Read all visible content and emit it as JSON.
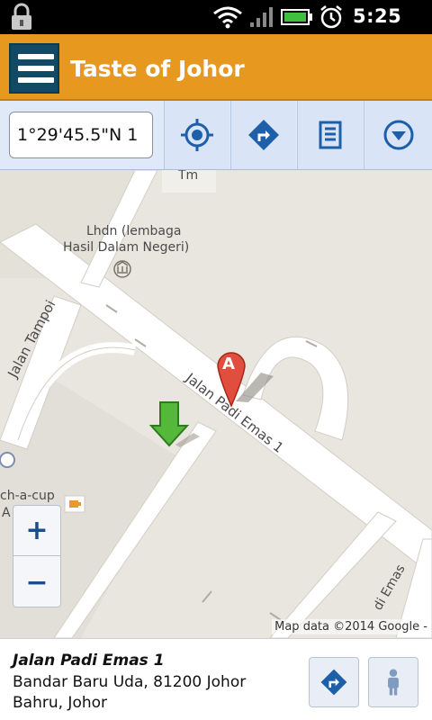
{
  "status_bar": {
    "time": "5:25",
    "ampm": "AM",
    "icons": [
      "lock-icon",
      "wifi-icon",
      "signal-icon",
      "battery-icon",
      "alarm-icon"
    ]
  },
  "app_bar": {
    "title": "Taste of Johor",
    "menu_icon": "hamburger-menu-icon",
    "color": "#e7981f"
  },
  "toolbar": {
    "coordinate_value": "1°29'45.5\"N 1",
    "buttons": [
      {
        "name": "my-location",
        "icon": "crosshair-icon"
      },
      {
        "name": "directions",
        "icon": "directions-icon"
      },
      {
        "name": "list",
        "icon": "list-icon"
      },
      {
        "name": "more",
        "icon": "chevron-down-circle-icon"
      }
    ]
  },
  "map": {
    "labels": {
      "tm": "Tm",
      "lhdn_line1": "Lhdn (lembaga",
      "lhdn_line2": "Hasil Dalam Negeri)",
      "jalan_tampoi": "Jalan Tampoi",
      "jalan_padi_emas": "Jalan Padi Emas 1",
      "cafe": "ch-a-cup",
      "cafe_line2": "A",
      "emas_fragment": "di Emas"
    },
    "marker_label": "A",
    "zoom_in": "+",
    "zoom_out": "−",
    "attribution": "Map data ©2014 Google -"
  },
  "place": {
    "title": "Jalan Padi Emas 1",
    "address": "Bandar Baru Uda, 81200 Johor Bahru, Johor"
  },
  "actions": {
    "directions_icon": "directions-icon",
    "streetview_icon": "pegman-icon"
  }
}
